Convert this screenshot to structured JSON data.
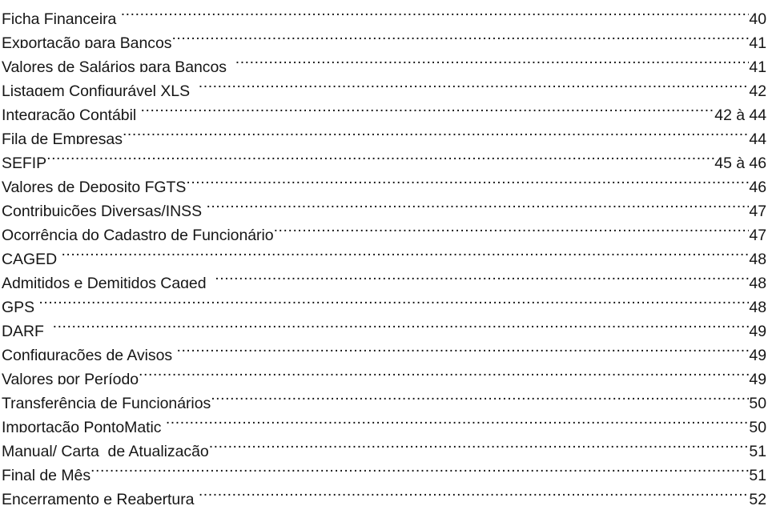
{
  "document": {
    "type": "table-of-contents",
    "background_color": "#ffffff",
    "text_color": "#161616"
  },
  "toc": {
    "entries": [
      {
        "title": "Ficha Financeira ",
        "page": "40"
      },
      {
        "title": "Exportação para Bancos",
        "page": "41"
      },
      {
        "title": "Valores de Salários para Bancos  ",
        "page": "41"
      },
      {
        "title": "Listagem Configurável XLS  ",
        "page": "42"
      },
      {
        "title": "Integração Contábil ",
        "page": "42 à 44"
      },
      {
        "title": "Fila de Empresas",
        "page": "44"
      },
      {
        "title": "SEFIP",
        "page": "45 à 46"
      },
      {
        "title": "Valores de Deposito FGTS",
        "page": "46"
      },
      {
        "title": "Contribuições Diversas/INSS ",
        "page": "47"
      },
      {
        "title": "Ocorrência do Cadastro de Funcionário",
        "page": "47"
      },
      {
        "title": "CAGED ",
        "page": "48"
      },
      {
        "title": "Admitidos e Demitidos Caged  ",
        "page": "48"
      },
      {
        "title": "GPS ",
        "page": "48"
      },
      {
        "title": "DARF  ",
        "page": "49"
      },
      {
        "title": "Configurações de Avisos ",
        "page": "49"
      },
      {
        "title": "Valores por Período",
        "page": "49"
      },
      {
        "title": "Transferência de Funcionários",
        "page": "50"
      },
      {
        "title": "Importação PontoMatic ",
        "page": "50"
      },
      {
        "title": "Manual/ Carta  de Atualização",
        "page": "51"
      },
      {
        "title": "Final de Mês",
        "page": "51"
      },
      {
        "title": "Encerramento e Reabertura ",
        "page": "52"
      }
    ]
  }
}
